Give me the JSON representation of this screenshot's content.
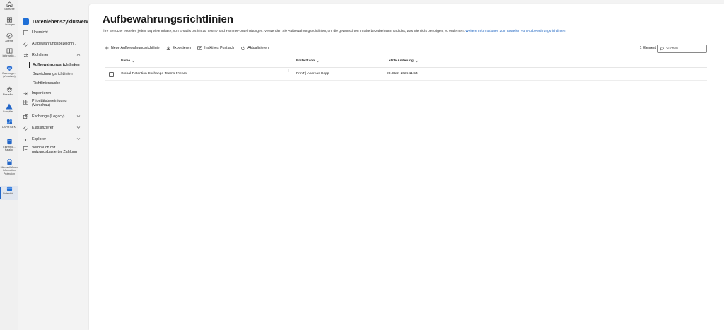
{
  "rail": {
    "items": [
      {
        "label": "Startseite",
        "icon": "home-icon"
      },
      {
        "label": "Lösungen",
        "icon": "grid-icon"
      },
      {
        "label": "Agents",
        "icon": "agents-icon"
      },
      {
        "label": "Informatio...",
        "icon": "information-icon"
      },
      {
        "label": "Datensign... (Vorschau)",
        "icon": "data-security-icon"
      },
      {
        "label": "Einstellun...",
        "icon": "settings-icon"
      },
      {
        "label": "Complian...",
        "icon": "compliance-icon"
      },
      {
        "label": "DSPM für KI",
        "icon": "dspm-icon"
      },
      {
        "label": "Einheitlic... Katalog",
        "icon": "catalog-icon"
      },
      {
        "label": "Microsoft Azure Information Protection",
        "icon": "aip-icon"
      },
      {
        "label": "Datenleb...",
        "icon": "data-lifecycle-icon"
      }
    ]
  },
  "nav": {
    "header": "Datenlebenszyklusverwaltung",
    "items": {
      "uebersicht": "Übersicht",
      "aufbewahrungsbezeichnungen": "Aufbewahrungsbezeichn...",
      "richtlinien": "Richtlinien",
      "aufbewahrungsrichtlinien": "Aufbewahrungsrichtlinien",
      "bezeichnungsrichtlinien": "Bezeichnungsrichtlinien",
      "richtliniensuche": "Richtliniensuche",
      "importieren": "Importieren",
      "prioritaet": "Prioritätsbereinigung (Vorschau)",
      "exchange": "Exchange (Legacy)",
      "klassifizierer": "Klassifizierer",
      "explorer": "Explorer",
      "verbrauch": "Verbrauch mit nutzungsbasierter Zahlung"
    }
  },
  "main": {
    "title": "Aufbewahrungsrichtlinien",
    "description": "Ihre Benutzer erstellen jeden Tag viele Inhalte, von E-Mails bis hin zu Teams- und Yammer-Unterhaltungen. Verwenden Sie Aufbewahrungsrichtlinien, um die gewünschten Inhalte beizubehalten und das, was Sie nicht benötigen, zu entfernen.",
    "learn_more": " Weitere Informationen zum Erstellen von Aufbewahrungsrichtlinien",
    "toolbar": {
      "new": "Neue Aufbewahrungsrichtlinie",
      "export": "Exportieren",
      "inactive": "Inaktives Postfach",
      "refresh": "Aktualisieren"
    },
    "count": "1 Element",
    "search_placeholder": "Suchen",
    "columns": {
      "name": "Name",
      "created_by": "Erstellt von",
      "modified": "Letzte Änderung"
    },
    "rows": [
      {
        "name": "Global-Retention-Exchange-Teams-5Years",
        "created_by": "PrinT | Andreas Hepp",
        "modified": "28. Dez. 2025 11:54"
      }
    ]
  },
  "colors": {
    "accent": "#1f6fd6",
    "link": "#1a62c0",
    "background": "#f3f3f3",
    "panel": "#ffffff"
  }
}
